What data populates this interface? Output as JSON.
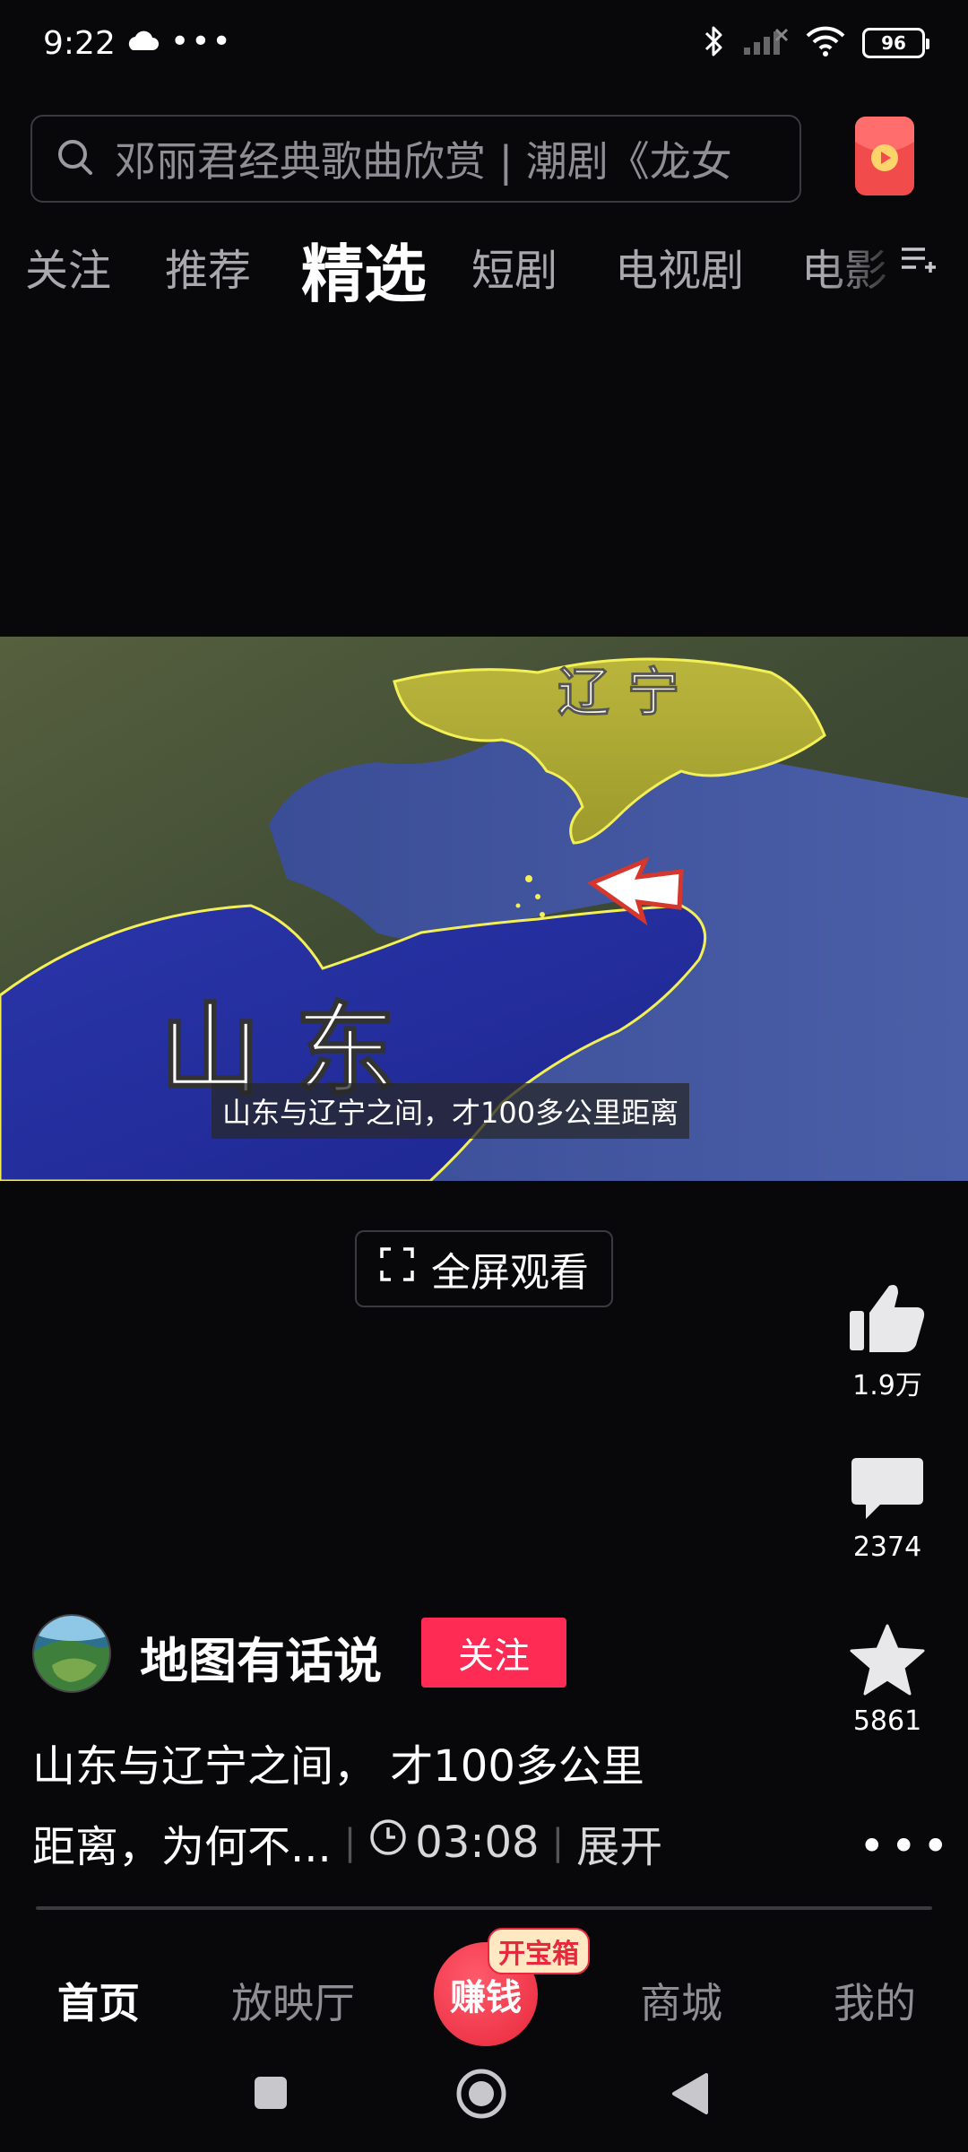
{
  "status_bar": {
    "time": "9:22",
    "dots": "•••",
    "battery": "96"
  },
  "search": {
    "query": "邓丽君经典歌曲欣赏 | 潮剧《龙女"
  },
  "tabs": [
    {
      "label": "关注"
    },
    {
      "label": "推荐"
    },
    {
      "label": "精选"
    },
    {
      "label": "短剧"
    },
    {
      "label": "电视剧"
    },
    {
      "label": "电影"
    }
  ],
  "video": {
    "map_label_north": "辽 宁",
    "map_label_south": "山 东",
    "caption": "山东与辽宁之间，才100多公里距离"
  },
  "fullscreen_label": "全屏观看",
  "actions": {
    "like_count": "1.9万",
    "comment_count": "2374",
    "favorite_count": "5861"
  },
  "author": {
    "name": "地图有话说",
    "follow_label": "关注"
  },
  "description": {
    "line1": "山东与辽宁之间， 才100多公里",
    "line2": "距离，为何不...",
    "duration": "03:08",
    "expand_label": "展开"
  },
  "progress": 0.0,
  "nav": {
    "home": "首页",
    "theater": "放映厅",
    "earn": "赚钱",
    "earn_badge": "开宝箱",
    "mall": "商城",
    "me": "我的"
  },
  "colors": {
    "accent": "#fe2c55",
    "background": "#08080a"
  }
}
